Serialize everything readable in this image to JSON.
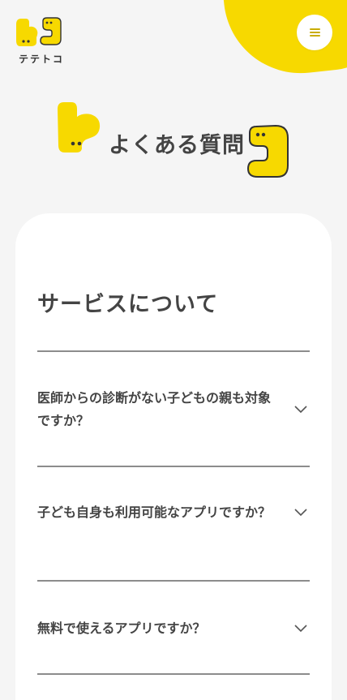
{
  "header": {
    "logo_text": "テテトコ",
    "menu_icon": "hamburger-icon",
    "accent_color": "#f7d900"
  },
  "hero": {
    "title": "よくある質問"
  },
  "faq": {
    "section_title": "サービスについて",
    "items": [
      {
        "question": "医師からの診断がない子どもの親も対象ですか？",
        "icon": "chevron-down-icon"
      },
      {
        "question": "子ども自身も利用可能なアプリですか？",
        "icon": "chevron-down-icon"
      },
      {
        "question": "無料で使えるアプリですか？",
        "icon": "chevron-down-icon"
      }
    ]
  }
}
